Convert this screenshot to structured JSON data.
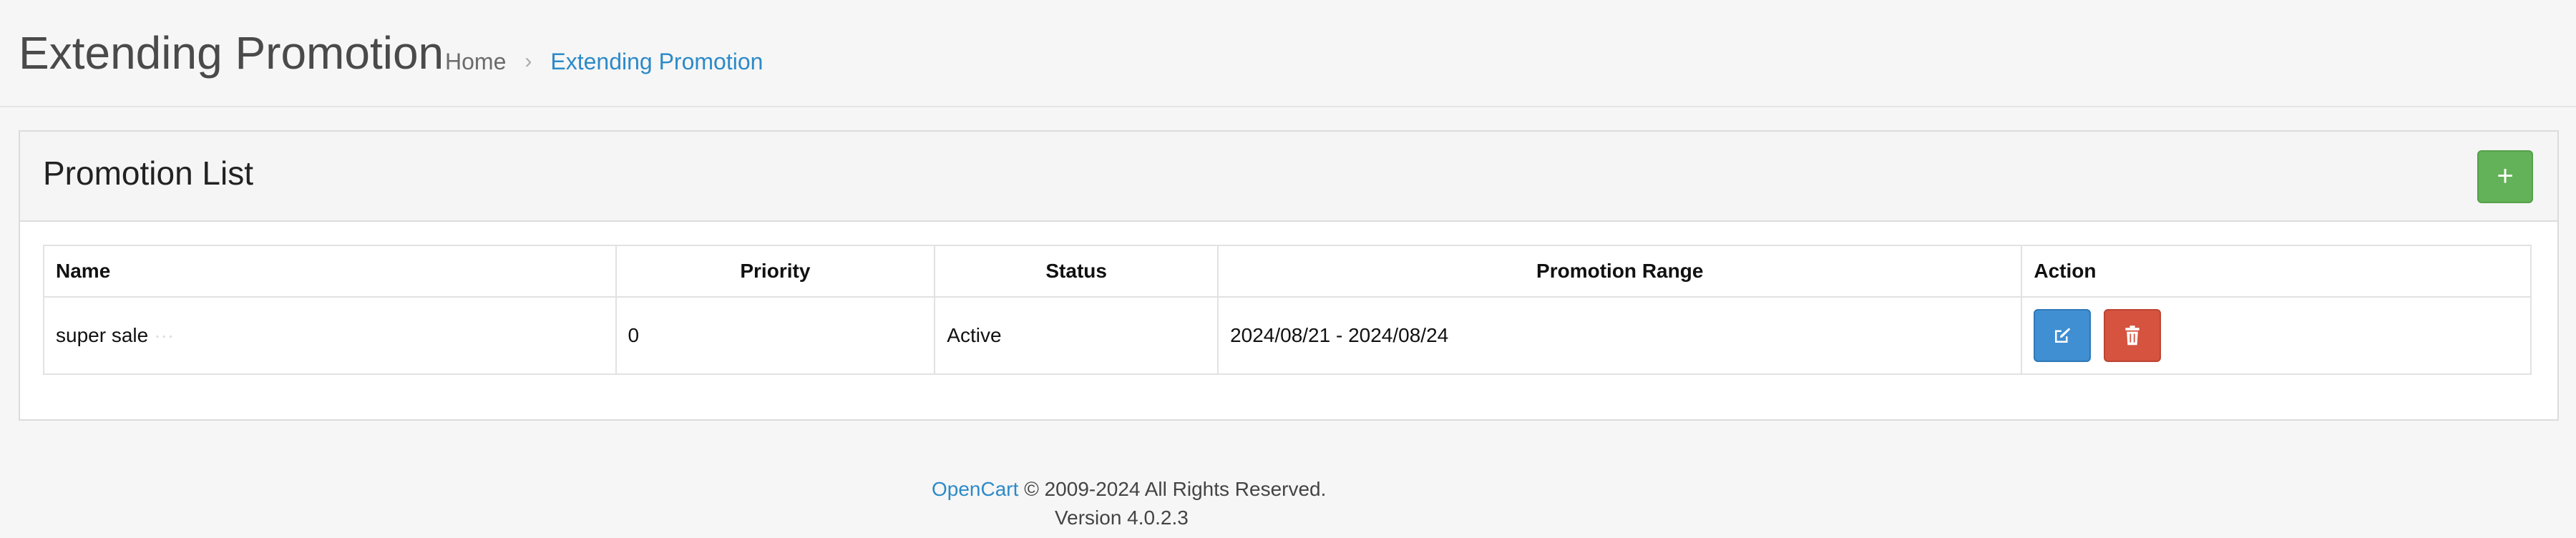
{
  "header": {
    "title": "Extending Promotion",
    "breadcrumb": {
      "home": "Home",
      "separator": "›",
      "current": "Extending Promotion"
    }
  },
  "card": {
    "title": "Promotion List",
    "add_button": "+"
  },
  "table": {
    "columns": {
      "name": "Name",
      "priority": "Priority",
      "status": "Status",
      "range": "Promotion Range",
      "action": "Action"
    },
    "rows": [
      {
        "name": "super sale",
        "priority": "0",
        "status": "Active",
        "range": "2024/08/21 - 2024/08/24"
      }
    ]
  },
  "footer": {
    "brand": "OpenCart",
    "copyright": "© 2009-2024 All Rights Reserved.",
    "version": "Version 4.0.2.3"
  },
  "colors": {
    "link": "#2c8ac8",
    "add": "#63b158",
    "edit": "#3f8fd2",
    "delete": "#d5533f"
  },
  "icons": {
    "add": "plus-icon",
    "edit": "edit-icon",
    "delete": "trash-icon"
  }
}
